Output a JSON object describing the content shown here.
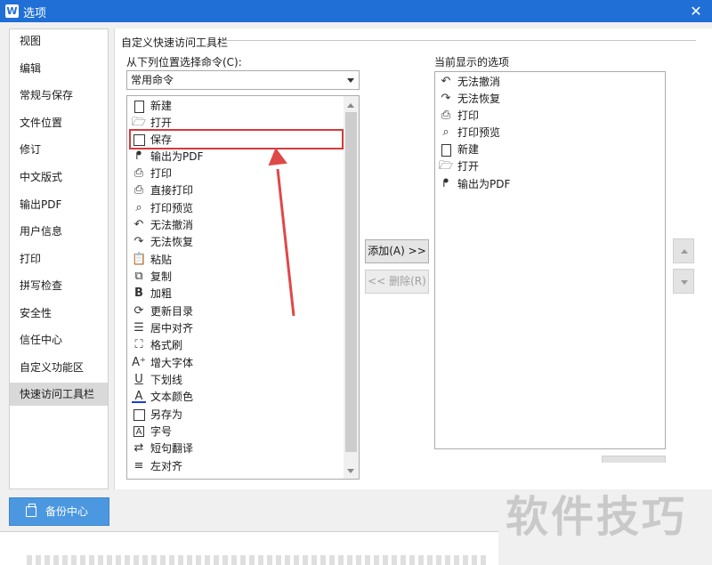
{
  "window": {
    "title": "选项",
    "app_icon_glyph": "W",
    "close_glyph": "✕"
  },
  "sidebar": {
    "items": [
      {
        "label": "视图"
      },
      {
        "label": "编辑"
      },
      {
        "label": "常规与保存"
      },
      {
        "label": "文件位置"
      },
      {
        "label": "修订"
      },
      {
        "label": "中文版式"
      },
      {
        "label": "输出PDF"
      },
      {
        "label": "用户信息"
      },
      {
        "label": "打印"
      },
      {
        "label": "拼写检查"
      },
      {
        "label": "安全性"
      },
      {
        "label": "信任中心"
      },
      {
        "label": "自定义功能区"
      },
      {
        "label": "快速访问工具栏",
        "active": true
      }
    ],
    "backup_label": "备份中心"
  },
  "main": {
    "group_title": "自定义快速访问工具栏",
    "choose_label": "从下列位置选择命令(C):",
    "dropdown_value": "常用命令",
    "commands": [
      {
        "label": "新建",
        "icon": "new-doc-icon"
      },
      {
        "label": "打开",
        "icon": "folder-icon"
      },
      {
        "label": "保存",
        "icon": "save-icon",
        "highlighted": true
      },
      {
        "label": "输出为PDF",
        "icon": "pdf-icon"
      },
      {
        "label": "打印",
        "icon": "print-icon"
      },
      {
        "label": "直接打印",
        "icon": "direct-print-icon"
      },
      {
        "label": "打印预览",
        "icon": "print-preview-icon"
      },
      {
        "label": "无法撤消",
        "icon": "undo-icon"
      },
      {
        "label": "无法恢复",
        "icon": "redo-icon"
      },
      {
        "label": "粘贴",
        "icon": "paste-icon"
      },
      {
        "label": "复制",
        "icon": "copy-icon"
      },
      {
        "label": "加粗",
        "icon": "bold-icon"
      },
      {
        "label": "更新目录",
        "icon": "update-toc-icon"
      },
      {
        "label": "居中对齐",
        "icon": "align-center-icon"
      },
      {
        "label": "格式刷",
        "icon": "format-painter-icon"
      },
      {
        "label": "增大字体",
        "icon": "grow-font-icon"
      },
      {
        "label": "下划线",
        "icon": "underline-icon"
      },
      {
        "label": "文本颜色",
        "icon": "font-color-icon"
      },
      {
        "label": "另存为",
        "icon": "save-as-icon"
      },
      {
        "label": "字号",
        "icon": "font-size-icon"
      },
      {
        "label": "短句翻译",
        "icon": "translate-icon"
      },
      {
        "label": "左对齐",
        "icon": "align-left-icon"
      }
    ],
    "add_button": "添加(A) >>",
    "remove_button": "<< 删除(R)",
    "current_label": "当前显示的选项",
    "current_items": [
      {
        "label": "无法撤消",
        "icon": "undo-icon"
      },
      {
        "label": "无法恢复",
        "icon": "redo-icon"
      },
      {
        "label": "打印",
        "icon": "print-icon"
      },
      {
        "label": "打印预览",
        "icon": "print-preview-icon"
      },
      {
        "label": "新建",
        "icon": "new-doc-icon"
      },
      {
        "label": "打开",
        "icon": "folder-icon"
      },
      {
        "label": "输出为PDF",
        "icon": "pdf-icon"
      }
    ]
  },
  "watermark": "软件技巧",
  "colors": {
    "titlebar": "#1f6fd6",
    "highlight_box": "#d63a3a",
    "annotation_arrow": "#e04848",
    "backup_button": "#4c98e0"
  }
}
